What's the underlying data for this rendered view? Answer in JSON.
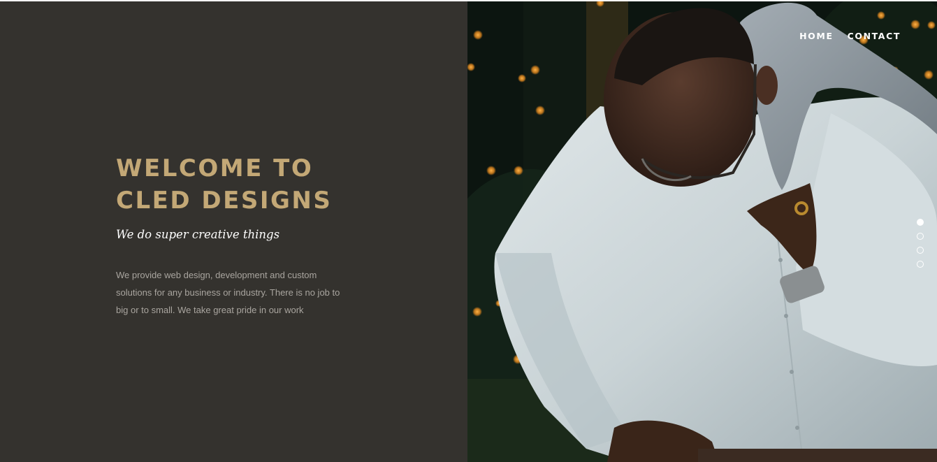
{
  "nav": {
    "home_label": "HOME",
    "contact_label": "CONTACT"
  },
  "hero": {
    "title_line1": "WELCOME TO",
    "title_line2": "CLED DESIGNS",
    "subtitle": "We do super creative things",
    "description": "We provide web design, development and custom solutions for any business or industry. There is no job to big or to small. We take great pride in our work"
  },
  "slider": {
    "slide_count": 4,
    "active_index": 0
  },
  "colors": {
    "left_panel_bg": "#34322e",
    "title_gold": "#c3a876",
    "description_gray": "#a9a59f"
  }
}
